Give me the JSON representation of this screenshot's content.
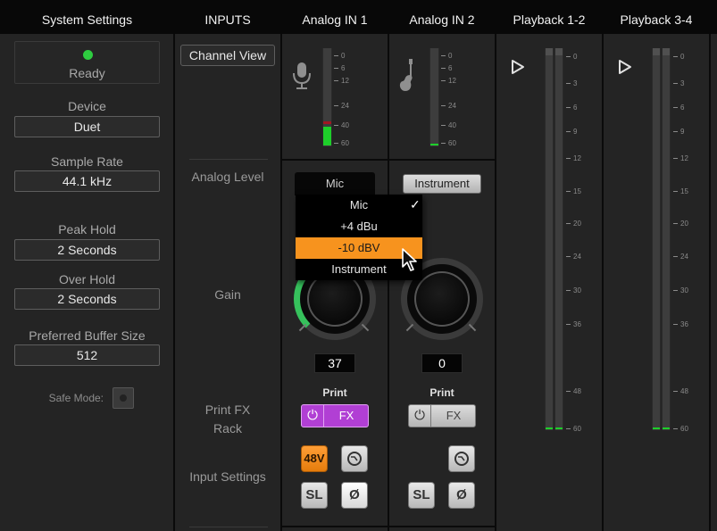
{
  "header": {
    "system_settings": "System Settings",
    "inputs": "INPUTS",
    "analog_in_1": "Analog IN 1",
    "analog_in_2": "Analog IN 2",
    "playback_1_2": "Playback 1-2",
    "playback_3_4": "Playback 3-4"
  },
  "system": {
    "status": "Ready",
    "status_color": "#2ecc40",
    "device_label": "Device",
    "device_value": "Duet",
    "sample_rate_label": "Sample Rate",
    "sample_rate_value": "44.1 kHz",
    "peak_hold_label": "Peak Hold",
    "peak_hold_value": "2 Seconds",
    "over_hold_label": "Over Hold",
    "over_hold_value": "2 Seconds",
    "buffer_label": "Preferred Buffer Size",
    "buffer_value": "512",
    "safe_mode_label": "Safe Mode:"
  },
  "inputs_col": {
    "channel_view": "Channel View",
    "analog_level": "Analog Level",
    "gain": "Gain",
    "print_fx_rack_1": "Print FX",
    "print_fx_rack_2": "Rack",
    "input_settings": "Input Settings"
  },
  "input_meter_ticks": [
    "0",
    "6",
    "12",
    "24",
    "40",
    "60"
  ],
  "playback_meter_ticks": [
    "0",
    "3",
    "6",
    "9",
    "12",
    "15",
    "20",
    "24",
    "30",
    "36",
    "48",
    "60"
  ],
  "ch1": {
    "level": "Mic",
    "gain": "37",
    "print_label": "Print",
    "fx_label": "FX",
    "phantom_label": "48V",
    "sl_label": "SL",
    "phase_label": "Ø",
    "icon": "microphone-icon"
  },
  "ch2": {
    "level": "Instrument",
    "gain": "0",
    "print_label": "Print",
    "fx_label": "FX",
    "sl_label": "SL",
    "phase_label": "Ø",
    "icon": "guitar-icon"
  },
  "level_menu": {
    "options": [
      "Mic",
      "+4 dBu",
      "-10 dBV",
      "Instrument"
    ],
    "selected": "Mic",
    "checkmark": "✓",
    "highlighted": "-10 dBV"
  },
  "colors": {
    "accent_orange": "#f7931e",
    "fx_purple": "#b13fd4",
    "meter_green": "#1ecf2a"
  }
}
